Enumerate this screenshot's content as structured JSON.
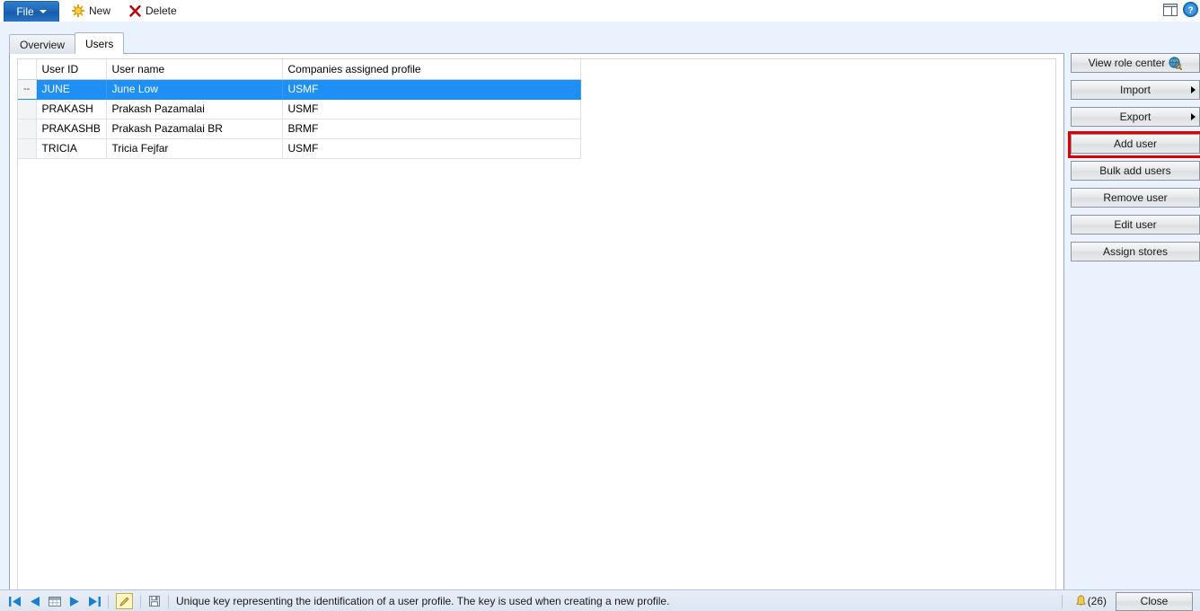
{
  "toolbar": {
    "file_label": "File",
    "file_caret_icon": "chevron-down-icon",
    "new_label": "New",
    "new_icon": "new-star-icon",
    "delete_label": "Delete",
    "delete_icon": "delete-x-icon",
    "window_layout_icon": "window-layout-icon",
    "help_icon": "help-circle-icon"
  },
  "tabs": [
    {
      "label": "Overview",
      "active": false
    },
    {
      "label": "Users",
      "active": true
    }
  ],
  "grid": {
    "columns": [
      "",
      "User ID",
      "User name",
      "Companies assigned profile"
    ],
    "rows": [
      {
        "marker": "--",
        "user_id": "JUNE",
        "user_name": "June Low",
        "company": "USMF",
        "selected": true
      },
      {
        "marker": "",
        "user_id": "PRAKASH",
        "user_name": "Prakash Pazamalai",
        "company": "USMF",
        "selected": false
      },
      {
        "marker": "",
        "user_id": "PRAKASHB",
        "user_name": "Prakash Pazamalai BR",
        "company": "BRMF",
        "selected": false
      },
      {
        "marker": "",
        "user_id": "TRICIA",
        "user_name": "Tricia Fejfar",
        "company": "USMF",
        "selected": false
      }
    ],
    "selection_color": "#1e90f5"
  },
  "sidebar": {
    "buttons": [
      {
        "label": "View role center",
        "icon": "globe-search-icon",
        "submenu": false,
        "highlighted": false
      },
      {
        "label": "Import",
        "icon": "",
        "submenu": true,
        "highlighted": false
      },
      {
        "label": "Export",
        "icon": "",
        "submenu": true,
        "highlighted": false
      },
      {
        "label": "Add user",
        "icon": "",
        "submenu": false,
        "highlighted": true
      },
      {
        "label": "Bulk add users",
        "icon": "",
        "submenu": false,
        "highlighted": false
      },
      {
        "label": "Remove user",
        "icon": "",
        "submenu": false,
        "highlighted": false
      },
      {
        "label": "Edit user",
        "icon": "",
        "submenu": false,
        "highlighted": false
      },
      {
        "label": "Assign stores",
        "icon": "",
        "submenu": false,
        "highlighted": false
      }
    ],
    "highlight_color": "#e00000"
  },
  "statusbar": {
    "nav_icons": [
      "first-record-icon",
      "previous-record-icon",
      "grid-view-icon",
      "next-record-icon",
      "last-record-icon"
    ],
    "edit_icon": "edit-pencil-icon",
    "save_icon": "save-icon",
    "message": "Unique key representing the identification of a user profile. The key is used when creating a new profile.",
    "notification_icon": "bell-icon",
    "notification_count": "(26)",
    "close_label": "Close"
  }
}
